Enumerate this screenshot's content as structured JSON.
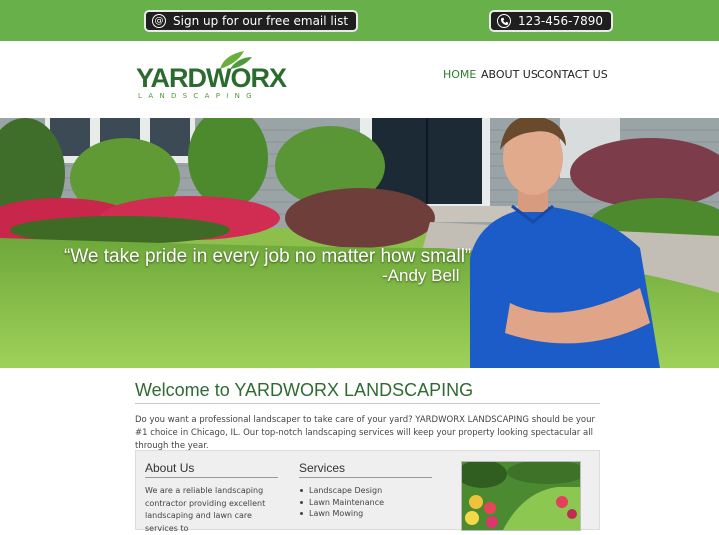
{
  "topbar": {
    "email_label": "Sign up for our free email list",
    "phone_label": "123-456-7890",
    "color": "#68b04a"
  },
  "logo": {
    "word": "YARDWORX",
    "sub": "LANDSCAPING"
  },
  "nav": [
    {
      "label": "HOME",
      "active": true
    },
    {
      "label": "ABOUT US",
      "active": false
    },
    {
      "label": "CONTACT US",
      "active": false
    }
  ],
  "hero": {
    "quote": "“We take pride in every job no matter how small”",
    "author": "-Andy Bell"
  },
  "main": {
    "title": "Welcome to YARDWORX LANDSCAPING",
    "intro": "Do you want a professional landscaper to take care of your yard? YARDWORX LANDSCAPING should be your #1 choice in Chicago, IL. Our top-notch landscaping services will keep your property looking spectacular all through the year."
  },
  "about": {
    "heading": "About Us",
    "text": "We are a reliable landscaping contractor providing excellent landscaping and lawn care services to"
  },
  "services": {
    "heading": "Services",
    "items": [
      "Landscape Design",
      "Lawn Maintenance",
      "Lawn Mowing"
    ]
  },
  "icons": {
    "email": "at-sign-icon",
    "phone": "phone-icon"
  }
}
